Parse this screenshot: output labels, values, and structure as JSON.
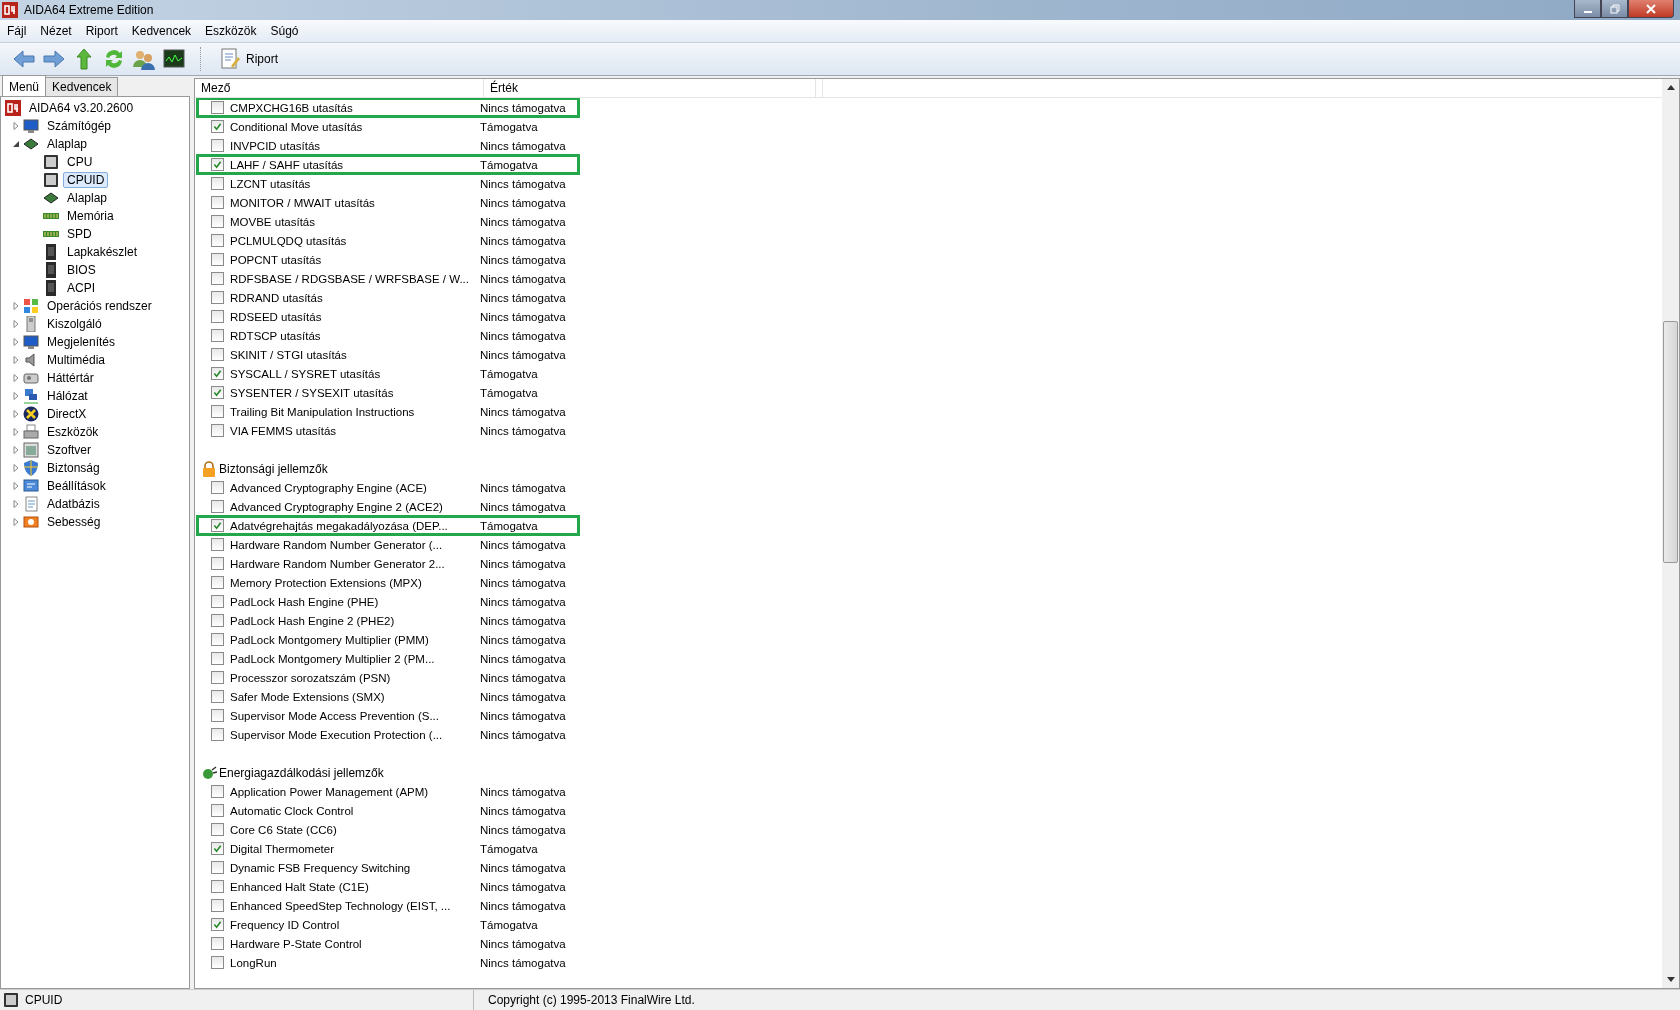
{
  "window": {
    "title": "AIDA64 Extreme Edition"
  },
  "menu": [
    "Fájl",
    "Nézet",
    "Riport",
    "Kedvencek",
    "Eszközök",
    "Súgó"
  ],
  "toolbar": {
    "report_button": "Riport"
  },
  "sidebar": {
    "tabs": [
      {
        "label": "Menü",
        "selected": true
      },
      {
        "label": "Kedvencek",
        "selected": false
      }
    ],
    "tree": [
      {
        "label": "AIDA64 v3.20.2600",
        "selected": false,
        "children": [
          {
            "label": "Számítógép",
            "selected": false,
            "expanded": false
          },
          {
            "label": "Alaplap",
            "selected": false,
            "expanded": true,
            "children": [
              {
                "label": "CPU",
                "selected": false
              },
              {
                "label": "CPUID",
                "selected": true
              },
              {
                "label": "Alaplap",
                "selected": false
              },
              {
                "label": "Memória",
                "selected": false
              },
              {
                "label": "SPD",
                "selected": false
              },
              {
                "label": "Lapkakészlet",
                "selected": false
              },
              {
                "label": "BIOS",
                "selected": false
              },
              {
                "label": "ACPI",
                "selected": false
              }
            ]
          },
          {
            "label": "Operációs rendszer",
            "selected": false,
            "expanded": false
          },
          {
            "label": "Kiszolgáló",
            "selected": false,
            "expanded": false
          },
          {
            "label": "Megjelenítés",
            "selected": false,
            "expanded": false
          },
          {
            "label": "Multimédia",
            "selected": false,
            "expanded": false
          },
          {
            "label": "Háttértár",
            "selected": false,
            "expanded": false
          },
          {
            "label": "Hálózat",
            "selected": false,
            "expanded": false
          },
          {
            "label": "DirectX",
            "selected": false,
            "expanded": false
          },
          {
            "label": "Eszközök",
            "selected": false,
            "expanded": false
          },
          {
            "label": "Szoftver",
            "selected": false,
            "expanded": false
          },
          {
            "label": "Biztonság",
            "selected": false,
            "expanded": false
          },
          {
            "label": "Beállítások",
            "selected": false,
            "expanded": false
          },
          {
            "label": "Adatbázis",
            "selected": false,
            "expanded": false
          },
          {
            "label": "Sebesség",
            "selected": false,
            "expanded": false
          }
        ]
      }
    ]
  },
  "table": {
    "columns": [
      "Mező",
      "Érték"
    ],
    "sections": [
      {
        "rows": [
          {
            "field": "CMPXCHG16B utasítás",
            "value": "Nincs támogatva",
            "checked": false,
            "highlighted": true
          },
          {
            "field": "Conditional Move utasítás",
            "value": "Támogatva",
            "checked": true,
            "highlighted": false
          },
          {
            "field": "INVPCID utasítás",
            "value": "Nincs támogatva",
            "checked": false,
            "highlighted": false
          },
          {
            "field": "LAHF / SAHF utasítás",
            "value": "Támogatva",
            "checked": true,
            "highlighted": true
          },
          {
            "field": "LZCNT utasítás",
            "value": "Nincs támogatva",
            "checked": false,
            "highlighted": false
          },
          {
            "field": "MONITOR / MWAIT utasítás",
            "value": "Nincs támogatva",
            "checked": false,
            "highlighted": false
          },
          {
            "field": "MOVBE utasítás",
            "value": "Nincs támogatva",
            "checked": false,
            "highlighted": false
          },
          {
            "field": "PCLMULQDQ utasítás",
            "value": "Nincs támogatva",
            "checked": false,
            "highlighted": false
          },
          {
            "field": "POPCNT utasítás",
            "value": "Nincs támogatva",
            "checked": false,
            "highlighted": false
          },
          {
            "field": "RDFSBASE / RDGSBASE / WRFSBASE / W...",
            "value": "Nincs támogatva",
            "checked": false,
            "highlighted": false
          },
          {
            "field": "RDRAND utasítás",
            "value": "Nincs támogatva",
            "checked": false,
            "highlighted": false
          },
          {
            "field": "RDSEED utasítás",
            "value": "Nincs támogatva",
            "checked": false,
            "highlighted": false
          },
          {
            "field": "RDTSCP utasítás",
            "value": "Nincs támogatva",
            "checked": false,
            "highlighted": false
          },
          {
            "field": "SKINIT / STGI utasítás",
            "value": "Nincs támogatva",
            "checked": false,
            "highlighted": false
          },
          {
            "field": "SYSCALL / SYSRET utasítás",
            "value": "Támogatva",
            "checked": true,
            "highlighted": false
          },
          {
            "field": "SYSENTER / SYSEXIT utasítás",
            "value": "Támogatva",
            "checked": true,
            "highlighted": false
          },
          {
            "field": "Trailing Bit Manipulation Instructions",
            "value": "Nincs támogatva",
            "checked": false,
            "highlighted": false
          },
          {
            "field": "VIA FEMMS utasítás",
            "value": "Nincs támogatva",
            "checked": false,
            "highlighted": false
          }
        ]
      },
      {
        "title": "Biztonsági jellemzők",
        "rows": [
          {
            "field": "Advanced Cryptography Engine (ACE)",
            "value": "Nincs támogatva",
            "checked": false,
            "highlighted": false
          },
          {
            "field": "Advanced Cryptography Engine 2 (ACE2)",
            "value": "Nincs támogatva",
            "checked": false,
            "highlighted": false
          },
          {
            "field": "Adatvégrehajtás megakadályozása (DEP...",
            "value": "Támogatva",
            "checked": true,
            "highlighted": true
          },
          {
            "field": "Hardware Random Number Generator (...",
            "value": "Nincs támogatva",
            "checked": false,
            "highlighted": false
          },
          {
            "field": "Hardware Random Number Generator 2...",
            "value": "Nincs támogatva",
            "checked": false,
            "highlighted": false
          },
          {
            "field": "Memory Protection Extensions (MPX)",
            "value": "Nincs támogatva",
            "checked": false,
            "highlighted": false
          },
          {
            "field": "PadLock Hash Engine (PHE)",
            "value": "Nincs támogatva",
            "checked": false,
            "highlighted": false
          },
          {
            "field": "PadLock Hash Engine 2 (PHE2)",
            "value": "Nincs támogatva",
            "checked": false,
            "highlighted": false
          },
          {
            "field": "PadLock Montgomery Multiplier (PMM)",
            "value": "Nincs támogatva",
            "checked": false,
            "highlighted": false
          },
          {
            "field": "PadLock Montgomery Multiplier 2 (PM...",
            "value": "Nincs támogatva",
            "checked": false,
            "highlighted": false
          },
          {
            "field": "Processzor sorozatszám (PSN)",
            "value": "Nincs támogatva",
            "checked": false,
            "highlighted": false
          },
          {
            "field": "Safer Mode Extensions (SMX)",
            "value": "Nincs támogatva",
            "checked": false,
            "highlighted": false
          },
          {
            "field": "Supervisor Mode Access Prevention (S...",
            "value": "Nincs támogatva",
            "checked": false,
            "highlighted": false
          },
          {
            "field": "Supervisor Mode Execution Protection (...",
            "value": "Nincs támogatva",
            "checked": false,
            "highlighted": false
          }
        ]
      },
      {
        "title": "Energiagazdálkodási jellemzők",
        "rows": [
          {
            "field": "Application Power Management (APM)",
            "value": "Nincs támogatva",
            "checked": false,
            "highlighted": false
          },
          {
            "field": "Automatic Clock Control",
            "value": "Nincs támogatva",
            "checked": false,
            "highlighted": false
          },
          {
            "field": "Core C6 State (CC6)",
            "value": "Nincs támogatva",
            "checked": false,
            "highlighted": false
          },
          {
            "field": "Digital Thermometer",
            "value": "Támogatva",
            "checked": true,
            "highlighted": false
          },
          {
            "field": "Dynamic FSB Frequency Switching",
            "value": "Nincs támogatva",
            "checked": false,
            "highlighted": false
          },
          {
            "field": "Enhanced Halt State (C1E)",
            "value": "Nincs támogatva",
            "checked": false,
            "highlighted": false
          },
          {
            "field": "Enhanced SpeedStep Technology (EIST, ...",
            "value": "Nincs támogatva",
            "checked": false,
            "highlighted": false
          },
          {
            "field": "Frequency ID Control",
            "value": "Támogatva",
            "checked": true,
            "highlighted": false
          },
          {
            "field": "Hardware P-State Control",
            "value": "Nincs támogatva",
            "checked": false,
            "highlighted": false
          },
          {
            "field": "LongRun",
            "value": "Nincs támogatva",
            "checked": false,
            "highlighted": false
          }
        ]
      }
    ]
  },
  "status_bar": {
    "left": "CPUID",
    "right": "Copyright (c) 1995-2013 FinalWire Ltd."
  }
}
